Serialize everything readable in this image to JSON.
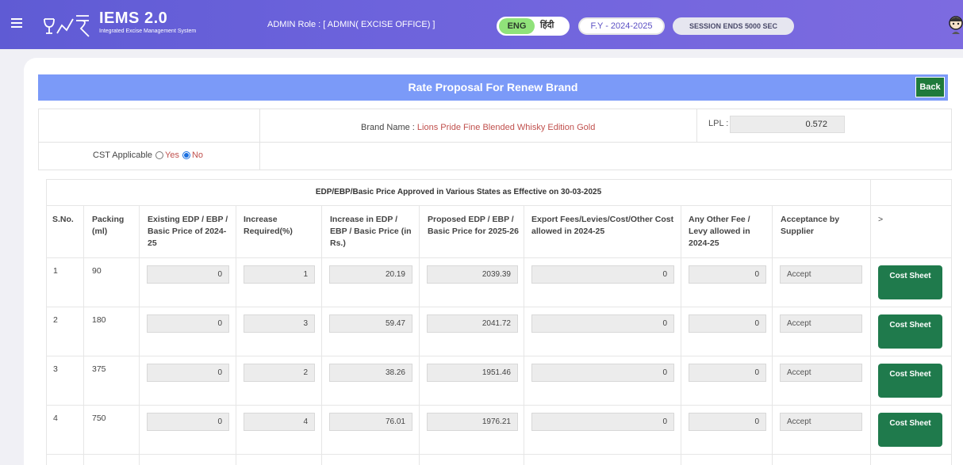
{
  "header": {
    "logo_title": "IEMS 2.0",
    "logo_subtitle": "Integrated Excise Management System",
    "admin_role": "ADMIN Role : [ ADMIN( EXCISE OFFICE) ]",
    "lang_english": "ENG",
    "lang_hindi": "हिंदी",
    "financial_year": "F.Y - 2024-2025",
    "session": "SESSION ENDS  5000 SEC"
  },
  "page": {
    "title": "Rate Proposal For Renew Brand",
    "back_label": "Back"
  },
  "info": {
    "brand_label": "Brand Name : ",
    "brand_value": "Lions Pride Fine Blended Whisky Edition Gold",
    "lpl_label": "LPL :",
    "lpl_value": "0.572",
    "cst_label": "CST Applicable",
    "cst_yes": "Yes",
    "cst_no": "No"
  },
  "table": {
    "caption": "EDP/EBP/Basic Price Approved in Various States as Effective on 30-03-2025",
    "headers": {
      "sno": "S.No.",
      "packing": "Packing (ml)",
      "existing": "Existing EDP / EBP / Basic Price of 2024-25",
      "increase_pct": "Increase Required(%)",
      "increase_rs": "Increase in EDP / EBP / Basic Price (in Rs.)",
      "proposed": "Proposed EDP / EBP / Basic Price for 2025-26",
      "export": "Export Fees/Levies/Cost/Other Cost allowed in 2024-25",
      "other_fee": "Any Other Fee / Levy allowed in 2024-25",
      "acceptance": "Acceptance by Supplier",
      "more": ">"
    },
    "rows": [
      {
        "sno": "1",
        "packing": "90",
        "existing": "0",
        "increase_pct": "1",
        "increase_rs": "20.19",
        "proposed": "2039.39",
        "export": "0",
        "other_fee": "0",
        "acceptance": "Accept",
        "action": "Cost Sheet"
      },
      {
        "sno": "2",
        "packing": "180",
        "existing": "0",
        "increase_pct": "3",
        "increase_rs": "59.47",
        "proposed": "2041.72",
        "export": "0",
        "other_fee": "0",
        "acceptance": "Accept",
        "action": "Cost Sheet"
      },
      {
        "sno": "3",
        "packing": "375",
        "existing": "0",
        "increase_pct": "2",
        "increase_rs": "38.26",
        "proposed": "1951.46",
        "export": "0",
        "other_fee": "0",
        "acceptance": "Accept",
        "action": "Cost Sheet"
      },
      {
        "sno": "4",
        "packing": "750",
        "existing": "0",
        "increase_pct": "4",
        "increase_rs": "76.01",
        "proposed": "1976.21",
        "export": "0",
        "other_fee": "0",
        "acceptance": "Accept",
        "action": "Cost Sheet"
      }
    ]
  },
  "colors": {
    "header_gradient_start": "#5f5bd4",
    "title_bar": "#7b9af8",
    "button_green": "#1f7a4c",
    "brand_text": "#c0504d"
  }
}
